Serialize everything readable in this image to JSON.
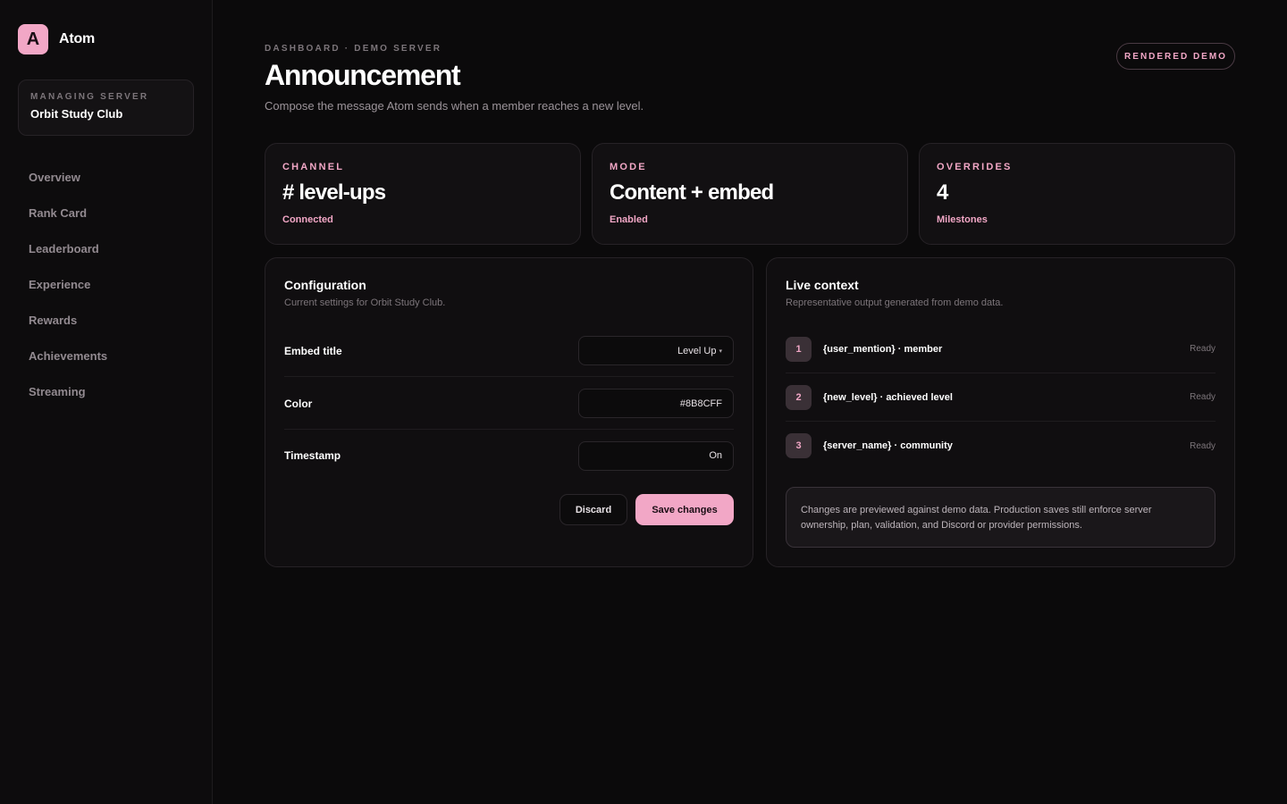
{
  "brand": {
    "logo_letter": "A",
    "name": "Atom",
    "accent": "#F2A7C6"
  },
  "server": {
    "kicker": "MANAGING SERVER",
    "name": "Orbit Study Club"
  },
  "nav": [
    {
      "label": "Overview"
    },
    {
      "label": "Rank Card"
    },
    {
      "label": "Leaderboard"
    },
    {
      "label": "Experience"
    },
    {
      "label": "Rewards"
    },
    {
      "label": "Achievements"
    },
    {
      "label": "Streaming"
    }
  ],
  "header": {
    "breadcrumb": "DASHBOARD · DEMO SERVER",
    "title": "Announcement",
    "subtitle": "Compose the message Atom sends when a member reaches a new level.",
    "badge": "RENDERED DEMO"
  },
  "stats": [
    {
      "label": "CHANNEL",
      "value": "# level-ups",
      "foot": "Connected"
    },
    {
      "label": "MODE",
      "value": "Content + embed",
      "foot": "Enabled"
    },
    {
      "label": "OVERRIDES",
      "value": "4",
      "foot": "Milestones"
    }
  ],
  "config": {
    "title": "Configuration",
    "subtitle": "Current settings for Orbit Study Club.",
    "fields": [
      {
        "label": "Embed title",
        "value": "Level Up",
        "caret": "▾"
      },
      {
        "label": "Color",
        "value": "#8B8CFF"
      },
      {
        "label": "Timestamp",
        "value": "On"
      }
    ],
    "discard_label": "Discard",
    "save_label": "Save changes"
  },
  "context": {
    "title": "Live context",
    "subtitle": "Representative output generated from demo data.",
    "items": [
      {
        "num": "1",
        "text": "{user_mention} · member",
        "status": "Ready"
      },
      {
        "num": "2",
        "text": "{new_level} · achieved level",
        "status": "Ready"
      },
      {
        "num": "3",
        "text": "{server_name} · community",
        "status": "Ready"
      }
    ],
    "notice": "Changes are previewed against demo data. Production saves still enforce server ownership, plan, validation, and Discord or provider permissions."
  }
}
